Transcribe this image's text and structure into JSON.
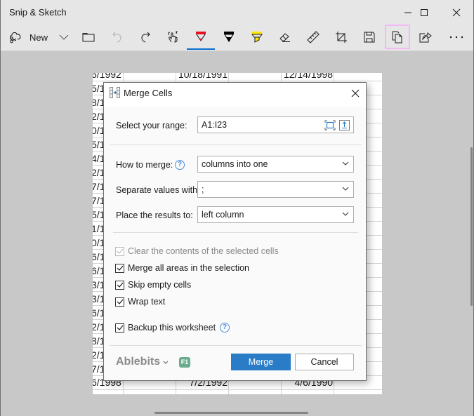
{
  "window": {
    "title": "Snip & Sketch",
    "controls": [
      "minimize",
      "maximize",
      "close"
    ]
  },
  "toolbar": {
    "new_label": "New",
    "items": [
      {
        "name": "new-snip",
        "icon": "snip-icon"
      },
      {
        "name": "new-dropdown",
        "icon": "chevron-down-icon"
      },
      {
        "name": "open-file",
        "icon": "folder-icon"
      },
      {
        "name": "undo",
        "icon": "undo-icon",
        "disabled": true
      },
      {
        "name": "redo",
        "icon": "redo-icon"
      },
      {
        "name": "touch-writing",
        "icon": "touch-icon"
      },
      {
        "name": "ballpoint-pen",
        "icon": "pen-icon",
        "color": "#e81123",
        "active": true
      },
      {
        "name": "pencil",
        "icon": "pencil-icon",
        "color": "#000000"
      },
      {
        "name": "highlighter",
        "icon": "highlighter-icon",
        "color": "#ffe600"
      },
      {
        "name": "eraser",
        "icon": "eraser-icon"
      },
      {
        "name": "ruler",
        "icon": "ruler-icon"
      },
      {
        "name": "crop",
        "icon": "crop-icon"
      },
      {
        "name": "save",
        "icon": "save-icon"
      },
      {
        "name": "copy",
        "icon": "copy-icon",
        "highlighted": true
      },
      {
        "name": "share",
        "icon": "share-icon"
      },
      {
        "name": "more",
        "icon": "more-icon"
      }
    ],
    "accent": "#0a6ed1",
    "highlight_color": "#f4b6f4"
  },
  "sheet": {
    "top_row": [
      "6/1992",
      "",
      "10/18/1991",
      "",
      "12/14/1998",
      ""
    ],
    "left_col_partial": [
      "5/1",
      "8/1",
      "2/1",
      "0/1",
      "5/1",
      "4/1",
      "2/1",
      "7/1",
      "7/1",
      "5/1",
      "1/1",
      "0/1",
      "6/1",
      "6/1",
      "3/1",
      "3/1",
      "6/1",
      "2/1",
      "8/1",
      "2/1",
      "7/1"
    ],
    "bottom_row": [
      "6/1998",
      "",
      "7/2/1992",
      "",
      "4/6/1990",
      ""
    ]
  },
  "dialog": {
    "title": "Merge Cells",
    "range_label": "Select your range:",
    "range_value": "A1:I23",
    "how_label": "How to merge:",
    "how_value": "columns into one",
    "separator_label": "Separate values with:",
    "separator_value": ";",
    "place_label": "Place the results to:",
    "place_value": "left column",
    "options": [
      {
        "label": "Clear the contents of the selected cells",
        "checked": true,
        "disabled": true
      },
      {
        "label": "Merge all areas in the selection",
        "checked": true,
        "disabled": false
      },
      {
        "label": "Skip empty cells",
        "checked": true,
        "disabled": false
      },
      {
        "label": "Wrap text",
        "checked": true,
        "disabled": false
      }
    ],
    "backup": {
      "label": "Backup this worksheet",
      "checked": true
    },
    "help_glyph": "?",
    "brand": "Ablebits",
    "f1_label": "F1",
    "merge_label": "Merge",
    "cancel_label": "Cancel",
    "primary_color": "#2a7cc7"
  }
}
